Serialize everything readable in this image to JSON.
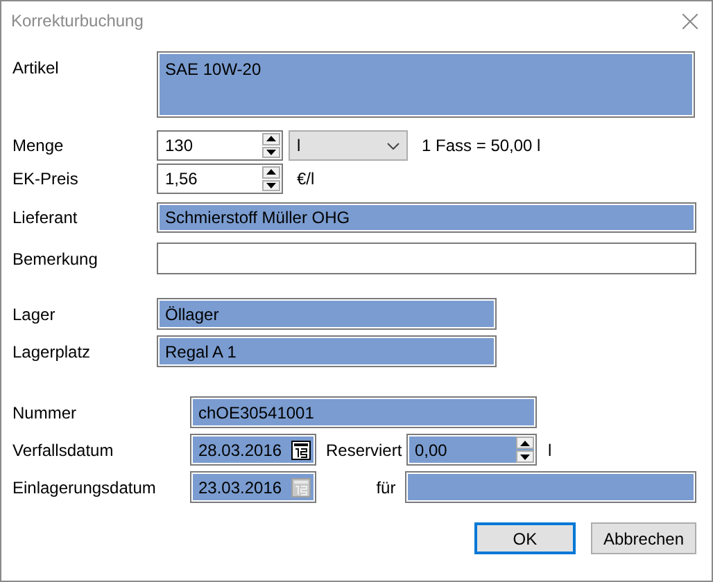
{
  "window": {
    "title": "Korrekturbuchung"
  },
  "article": {
    "label": "Artikel",
    "value": "SAE 10W-20",
    "highlighted": true
  },
  "quantity": {
    "label": "Menge",
    "value": "130",
    "highlighted": false,
    "unit": "l",
    "conversion": "1 Fass = 50,00 l"
  },
  "price": {
    "label": "EK-Preis",
    "value": "1,56",
    "highlighted": false,
    "unit": "€/l"
  },
  "supplier": {
    "label": "Lieferant",
    "value": "Schmierstoff Müller OHG",
    "highlighted": true
  },
  "remark": {
    "label": "Bemerkung",
    "highlighted": false
  },
  "storage": {
    "label": "Lager",
    "value": "Öllager",
    "highlighted": true
  },
  "storage_place": {
    "label": "Lagerplatz",
    "value": "Regal A 1",
    "highlighted": true
  },
  "number": {
    "label": "Nummer",
    "value": "chOE30541001",
    "highlighted": true
  },
  "expiry_date": {
    "label": "Verfallsdatum",
    "value": "28.03.2016",
    "highlighted": true,
    "picker_disabled": false
  },
  "reserved": {
    "label": "Reserviert",
    "value": "0,00",
    "highlighted": true,
    "unit": "l"
  },
  "storage_date": {
    "label": "Einlagerungsdatum",
    "value": "23.03.2016",
    "highlighted": true,
    "picker_disabled": true
  },
  "for": {
    "label": "für",
    "highlighted": true
  },
  "buttons": [
    {
      "label": "OK",
      "default": true
    },
    {
      "label": "Abbrechen",
      "default": false
    }
  ]
}
